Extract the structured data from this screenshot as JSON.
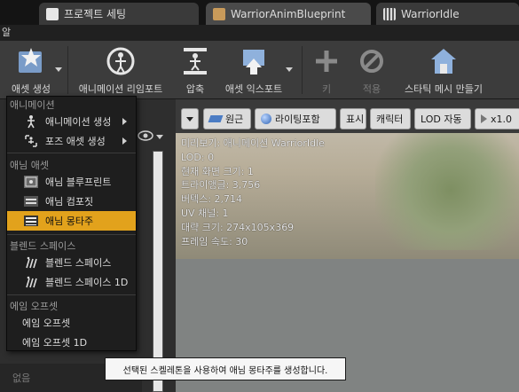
{
  "tabs": [
    {
      "label": "프로젝트 세팅",
      "icon": "settings-icon"
    },
    {
      "label": "WarriorAnimBlueprint",
      "icon": "anim-blueprint-icon"
    },
    {
      "label": "WarriorIdle",
      "icon": "anim-sequence-icon"
    }
  ],
  "menubar": {
    "label": "알"
  },
  "toolbar": {
    "create_asset": "애셋 생성",
    "reimport_animation": "애니메이션 리임포트",
    "compress": "압축",
    "export_asset": "애셋 익스포트",
    "key": "키",
    "apply": "적용",
    "make_static_mesh": "스타틱 메시 만들기"
  },
  "viewport": {
    "buttons": {
      "perspective": "원근",
      "lit": "라이팅포함",
      "show": "표시",
      "character": "캐릭터",
      "lod": "LOD 자동",
      "speed": "x1.0"
    },
    "info": [
      "미리보기: 애니메이션 WarriorIdle",
      "LOD: 0",
      "현재 화면 크기: 1",
      "트라이앵글: 3,756",
      "버텍스: 2,714",
      "UV 채널: 1",
      "대략 크기: 274x105x369",
      "프레임 속도: 30"
    ]
  },
  "menu": {
    "sections": {
      "animation": "애니메이션",
      "anim_asset": "애님 애셋",
      "blend_space": "블렌드 스페이스",
      "aim_offset": "에임 오프셋"
    },
    "items": {
      "create_animation": "애니메이션 생성",
      "create_pose_asset": "포즈 애셋 생성",
      "anim_blueprint": "애님 블루프린트",
      "anim_composite": "애님 컴포짓",
      "anim_montage": "애님 몽타주",
      "blend_space": "블렌드 스페이스",
      "blend_space_1d": "블렌드 스페이스 1D",
      "aim_offset": "에임 오프셋",
      "aim_offset_1d": "에임 오프셋 1D"
    }
  },
  "left_panel": {
    "hint": "없음"
  },
  "tooltip": "선택된 스켈레톤을 사용하여 애님 몽타주를 생성합니다.",
  "colors": {
    "highlight": "#e2a21c",
    "tab_bg": "#3a3a3a",
    "toolbar_bg": "#3c3c3c"
  }
}
